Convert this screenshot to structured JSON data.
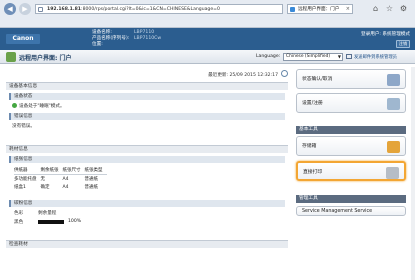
{
  "browser": {
    "address_host": "192.168.1.81",
    "address_rest": ":8000/rps/portal.cgi?lt=0&ic=1&CN=CHINESE&Language=0",
    "tab_title": "远程用户界面：门户"
  },
  "device": {
    "logo": "Canon",
    "name_label": "设备名称:",
    "name_value": "LBP7110",
    "product_label": "产品名称(序列号):",
    "product_value": "LBP7110Cw",
    "location_label": "位置:",
    "location_value": "",
    "login_user": "登录用户: 系统管理模式",
    "logout_label": "注销"
  },
  "titlebar": {
    "title": "远程用户界面: 门户",
    "language_label": "Language:",
    "language_value": "Chinese (Simplified)",
    "mail_link": "发送邮件到系统管理员"
  },
  "main": {
    "last_updated": "最近更新: 25/09 2015 12:32:17",
    "device_basic_info": "设备基本信息",
    "device_status_head": "设备状态",
    "device_status_text": "设备处于\"睡眠\"模式。",
    "error_head": "错误信息",
    "error_text": "没有错误。",
    "consumables_head": "耗材信息",
    "paper_head": "纸张信息",
    "paper_columns": [
      "供纸器",
      "剩余纸张",
      "纸张尺寸",
      "纸张类型"
    ],
    "paper_rows": [
      [
        "多功能托盘",
        "无",
        "A4",
        "普通纸"
      ],
      [
        "纸盒1",
        "确定",
        "A4",
        "普通纸"
      ]
    ],
    "cartridge_head": "碳粉信息",
    "cartridge_columns": [
      "色彩",
      "剩余量程"
    ],
    "cartridge_color": "黑色",
    "cartridge_level_text": "100%",
    "cartridge_level": 1.0,
    "bottom_section": "检查耗材"
  },
  "sidebar": {
    "status_button": "状态确认/取消",
    "settings_button": "设置/注册",
    "basic_tools_head": "基本工具",
    "address_book_button": "存储箱",
    "direct_print_button": "直接打印",
    "mgmt_tools_head": "管理工具",
    "service_mgmt_button": "Service Management Service"
  }
}
